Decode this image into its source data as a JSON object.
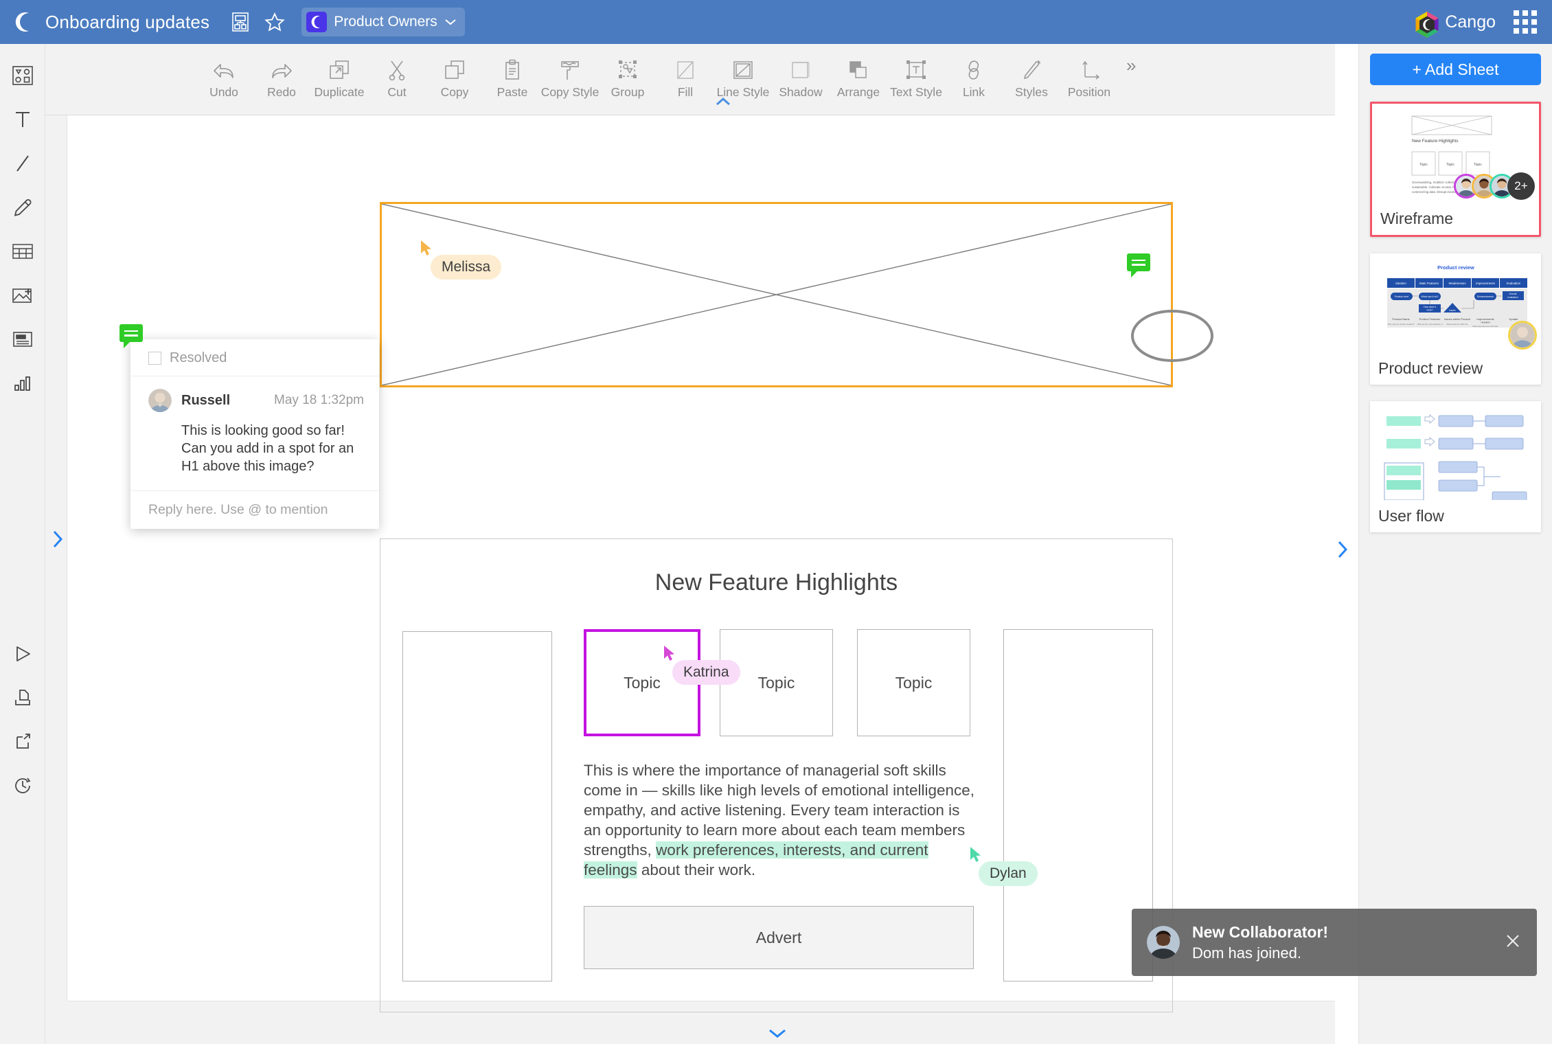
{
  "topbar": {
    "logo_icon": "moon-logo",
    "doc_title": "Onboarding updates",
    "diagram_icon": "org-chart-icon",
    "favorite_icon": "star-icon",
    "team_badge_icon": "moon-logo",
    "team_name": "Product Owners",
    "team_caret_icon": "chevron-down-icon",
    "brand_logo_icon": "cango-hex-logo",
    "brand_name": "Cango",
    "apps_icon": "grid-apps-icon"
  },
  "left_rail": {
    "tools": [
      {
        "name": "shapes-tool",
        "icon": "shapes-icon"
      },
      {
        "name": "text-tool",
        "icon": "text-t-icon"
      },
      {
        "name": "line-tool",
        "icon": "line-icon"
      },
      {
        "name": "pencil-tool",
        "icon": "pencil-icon"
      },
      {
        "name": "table-tool",
        "icon": "table-icon"
      },
      {
        "name": "image-tool",
        "icon": "image-plus-icon"
      },
      {
        "name": "textblock-tool",
        "icon": "text-block-icon"
      },
      {
        "name": "chart-tool",
        "icon": "bar-chart-icon"
      }
    ],
    "bottom_tools": [
      {
        "name": "present-tool",
        "icon": "play-icon"
      },
      {
        "name": "import-tool",
        "icon": "import-icon"
      },
      {
        "name": "export-tool",
        "icon": "export-icon"
      },
      {
        "name": "history-tool",
        "icon": "clock-history-icon"
      }
    ]
  },
  "ribbon": {
    "items": [
      {
        "label": "Undo",
        "icon": "undo-arrow-icon"
      },
      {
        "label": "Redo",
        "icon": "redo-arrow-icon"
      },
      {
        "label": "Duplicate",
        "icon": "duplicate-icon"
      },
      {
        "label": "Cut",
        "icon": "scissors-icon"
      },
      {
        "label": "Copy",
        "icon": "copy-icon"
      },
      {
        "label": "Paste",
        "icon": "clipboard-icon"
      },
      {
        "label": "Copy Style",
        "icon": "paint-roller-icon"
      },
      {
        "label": "Group",
        "icon": "group-icon"
      },
      {
        "label": "Fill",
        "icon": "fill-icon"
      },
      {
        "label": "Line Style",
        "icon": "line-style-icon"
      },
      {
        "label": "Shadow",
        "icon": "shadow-icon"
      },
      {
        "label": "Arrange",
        "icon": "arrange-icon"
      },
      {
        "label": "Text Style",
        "icon": "text-style-icon"
      },
      {
        "label": "Link",
        "icon": "link-icon"
      },
      {
        "label": "Styles",
        "icon": "magic-wand-icon"
      },
      {
        "label": "Position",
        "icon": "position-axes-icon"
      }
    ],
    "more_label": "»",
    "collapse_icon": "chevron-up-icon"
  },
  "canvas": {
    "image_placeholder": {
      "name": "image-placeholder",
      "selected": true
    },
    "ellipse_annotation": {
      "name": "ellipse-annotation"
    },
    "comment_pin": {
      "name": "comment-pin-icon"
    },
    "cursors": [
      {
        "name": "Melissa",
        "color": "#fdeccf"
      },
      {
        "name": "Katrina",
        "color": "#f8dcf8"
      },
      {
        "name": "Dylan",
        "color": "#d2f5e6"
      }
    ],
    "wireframe": {
      "title": "New Feature Highlights",
      "topics": [
        "Topic",
        "Topic",
        "Topic"
      ],
      "body_before_highlight": "This is where the importance of managerial soft skills come in — skills like high levels of emotional intelligence, empathy, and active listening. Every team interaction is an opportunity to learn more about each team members strengths, ",
      "body_highlight": "work preferences, interests, and current feelings",
      "body_after_highlight": " about their work.",
      "advert_label": "Advert"
    }
  },
  "comment_popup": {
    "resolved_label": "Resolved",
    "resolved_checked": false,
    "author": "Russell",
    "timestamp": "May 18 1:32pm",
    "message": "This is looking good so far! Can you add in a spot for an H1 above this image?",
    "reply_placeholder": "Reply here. Use @ to mention"
  },
  "right_panel": {
    "add_sheet_label": "+ Add Sheet",
    "sheets": [
      {
        "name": "Wireframe",
        "active": true,
        "thumb_title": "New Feature Highlights",
        "thumb_topics": [
          "Topic",
          "Topic",
          "Topic"
        ],
        "thumb_body": "Greenwashing, mobilize collective impact sustainable. Cultivate circular, her but centered big data. Disrupt involving",
        "avatar_overflow": "2+"
      },
      {
        "name": "Product review",
        "active": false,
        "thumb_title": "Product review",
        "thumb_columns": [
          "Ideation",
          "Main Features",
          "Weaknesses",
          "Improvements",
          "Evaluation"
        ],
        "thumb_nodes": [
          "Product brief",
          "What can it do?",
          "How does it work?",
          "Issues",
          "Enhancements",
          "Overall evaluation"
        ],
        "thumb_captions": [
          "Product Name",
          "Product Features",
          "Issues within Product",
          "Improvements needed",
          "Update"
        ]
      },
      {
        "name": "User flow",
        "active": false
      }
    ]
  },
  "toast": {
    "title": "New Collaborator!",
    "subtitle": "Dom has joined.",
    "close_icon": "close-icon"
  },
  "edge_controls": {
    "left_expand_icon": "chevron-right-icon",
    "right_expand_icon": "chevron-right-icon",
    "bottom_expand_icon": "chevron-down-icon"
  },
  "colors": {
    "topbar": "#4a7bc0",
    "accent_blue": "#2584f5",
    "selection_orange": "#f5a623",
    "selection_purple": "#c413e0",
    "active_sheet": "#f4566b",
    "comment_green": "#2fcc27",
    "highlight_green": "#c3f3e0"
  }
}
